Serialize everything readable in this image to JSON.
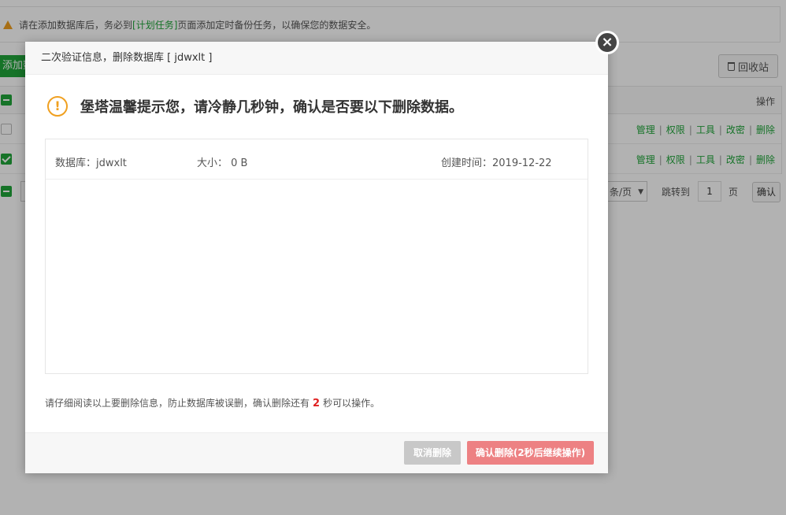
{
  "notice": {
    "prefix": "请在添加数据库后，务必到",
    "link": "[计划任务]",
    "suffix": "页面添加定时备份任务，以确保您的数据安全。"
  },
  "toolbar": {
    "add_label": "添加数",
    "recycle_label": "回收站"
  },
  "table": {
    "header_ops": "操作",
    "row_ops": [
      "管理",
      "权限",
      "工具",
      "改密",
      "删除"
    ],
    "sep": "|"
  },
  "pager": {
    "per_page": "条/页",
    "jump_label": "跳转到",
    "page_value": "1",
    "page_unit": "页",
    "confirm_label": "确认"
  },
  "modal": {
    "title": "二次验证信息，删除数据库 [ jdwxlt ]",
    "close_glyph": "×",
    "alert_glyph": "!",
    "headline": "堡塔温馨提示您，请冷静几秒钟，确认是否要以下删除数据。",
    "info": {
      "db_label": "数据库：jdwxlt",
      "size_label": "大小： 0 B",
      "created_label": "创建时间：2019-12-22"
    },
    "hint_prefix": "请仔细阅读以上要删除信息，防止数据库被误删，确认删除还有",
    "countdown": "2",
    "hint_suffix": "秒可以操作。",
    "cancel_label": "取消删除",
    "confirm_label": "确认删除(2秒后继续操作)"
  },
  "colors": {
    "brand_green": "#20a53a",
    "warning": "#f0a020",
    "danger_red": "#e02020",
    "confirm_bg": "#ed8183"
  }
}
